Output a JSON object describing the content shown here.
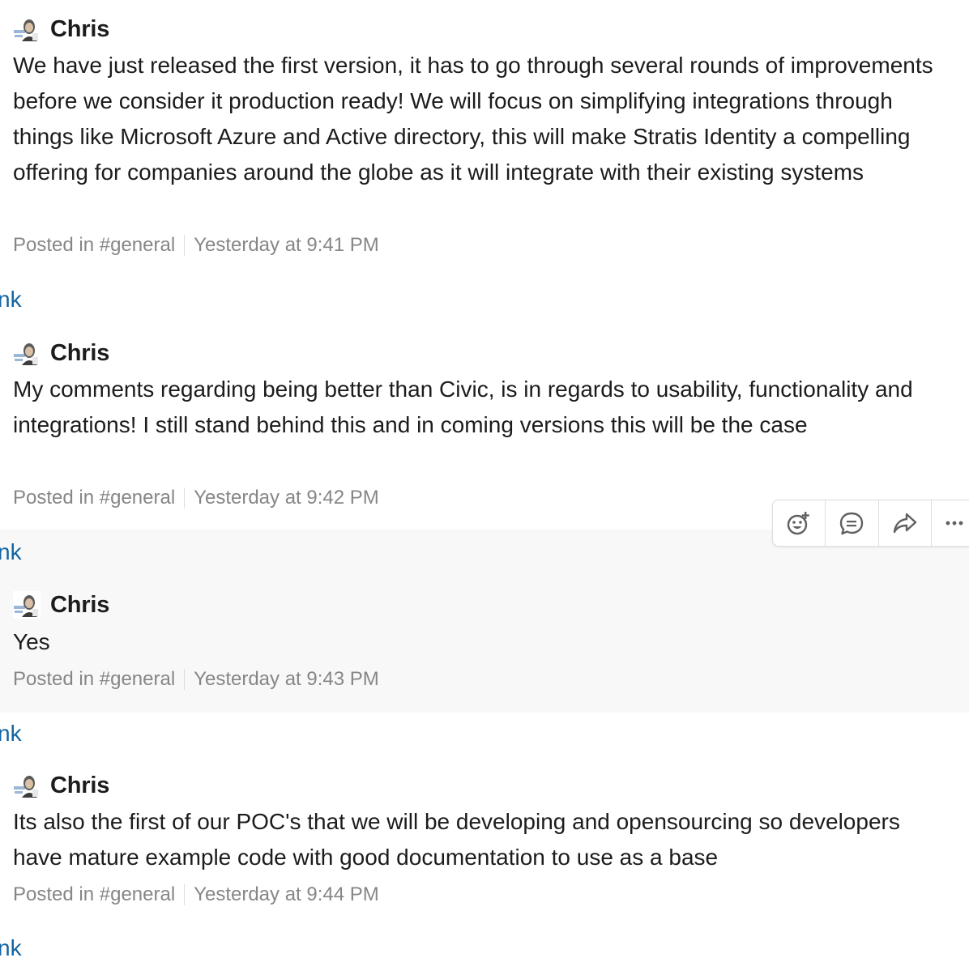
{
  "messages": [
    {
      "author": "Chris",
      "avatar_icon": "user-avatar-icon",
      "text": "We have just released the first version, it has to go through several rounds of improvements before we consider it production ready! We will focus on simplifying integrations through things like Microsoft Azure and Active directory, this will make Stratis Identity a compelling offering for companies around the globe as it will integrate with their existing systems",
      "posted_prefix": "Posted in ",
      "channel": "#general",
      "timestamp": "Yesterday at 9:41 PM",
      "link_fragment": "nk"
    },
    {
      "author": "Chris",
      "avatar_icon": "user-avatar-icon",
      "text": "My comments regarding being better than Civic, is in regards to usability, functionality and integrations! I still stand behind this and in coming versions this will be the case",
      "posted_prefix": "Posted in ",
      "channel": "#general",
      "timestamp": "Yesterday at 9:42 PM",
      "link_fragment": "nk"
    },
    {
      "author": "Chris",
      "avatar_icon": "user-avatar-icon",
      "text": "Yes",
      "posted_prefix": "Posted in ",
      "channel": "#general",
      "timestamp": "Yesterday at 9:43 PM",
      "link_fragment": "nk"
    },
    {
      "author": "Chris",
      "avatar_icon": "user-avatar-icon",
      "text": "Its also the first of our POC's that we will be developing and opensourcing so developers have mature example code with good documentation to use as a base",
      "posted_prefix": "Posted in ",
      "channel": "#general",
      "timestamp": "Yesterday at 9:44 PM",
      "link_fragment": "nk"
    }
  ],
  "message_actions": {
    "buttons": [
      "add-reaction-icon",
      "reply-thread-icon",
      "share-message-icon",
      "more-actions-icon"
    ]
  },
  "colors": {
    "link": "#1264a3",
    "meta": "#868686",
    "hover_bg": "#f8f8f8"
  }
}
